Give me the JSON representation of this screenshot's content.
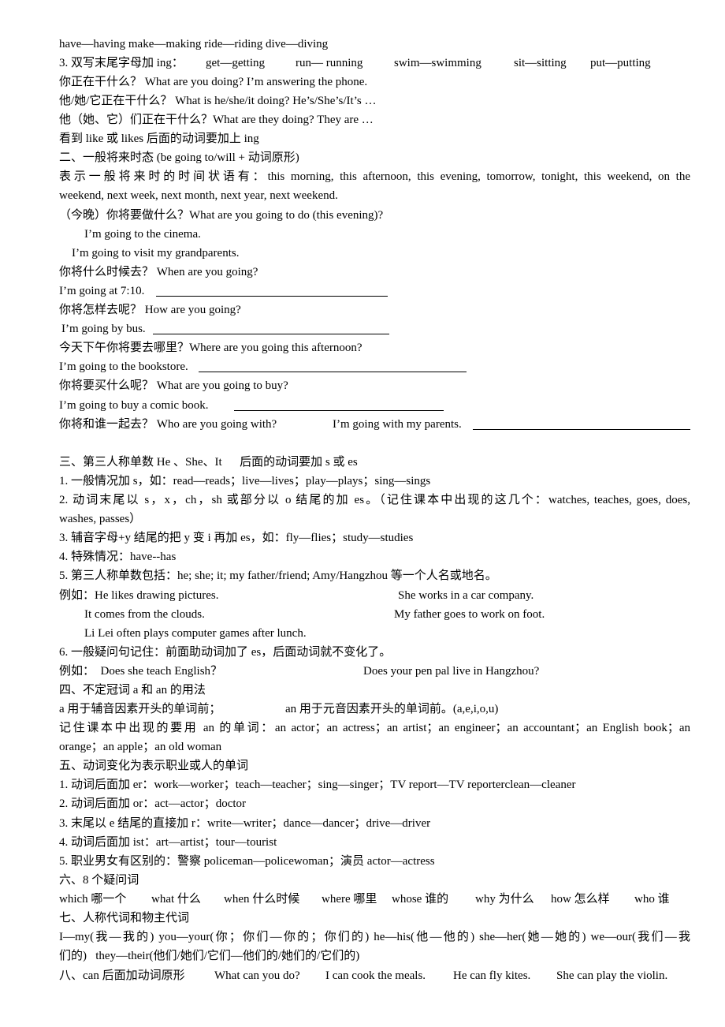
{
  "lines": {
    "l1": "have—having  make—making  ride—riding  dive—diving",
    "l2": [
      "3. 双写末尾字母加 ing：",
      "get—getting",
      "run— running",
      "swim—swimming",
      "sit—sitting",
      "put—putting"
    ],
    "l3": "你正在干什么？ What are you doing? I’m answering the phone.",
    "l4": "他/她/它正在干什么？ What is he/she/it doing?  He’s/She’s/It’s …",
    "l5": "他（她、它）们正在干什么？What are they doing?  They are …",
    "l6": "看到 like 或 likes 后面的动词要加上 ing",
    "s2": "二、一般将来时态 (be going to/will + 动词原形)",
    "l7": "表示一般将来时的时间状语有：this morning, this afternoon, this evening, tomorrow, tonight, this weekend, on the",
    "l8": "weekend, next week, next month, next year, next weekend.",
    "l9": "（今晚）你将要做什么？What are you going to do (this evening)?",
    "l10": "I’m going to the cinema.",
    "l11": "I’m going to visit my grandparents.",
    "l12": "你将什么时候去？ When are you going?",
    "l13": "I’m going at 7:10.",
    "l14": "你将怎样去呢？  How are you going?",
    "l15": "I’m going by bus.",
    "l16": "今天下午你将要去哪里？Where are you going this afternoon?",
    "l17": "I’m going to the bookstore.",
    "l18": "你将要买什么呢？ What are you going to buy?",
    "l19": "I’m going to buy a comic book.",
    "l20": [
      "你将和谁一起去？ Who are you going with?",
      "I’m going with my parents."
    ],
    "s3": "三、第三人称单数 He 、She、It      后面的动词要加 s 或 es",
    "l21": "1. 一般情况加 s，如：read—reads；live—lives；play—plays；sing—sings",
    "l22": "2. 动词末尾以 s，x，ch，sh 或部分以 o 结尾的加 es。（记住课本中出现的这几个：watches, teaches, goes, does,",
    "l23": "washes, passes）",
    "l24": "3. 辅音字母+y 结尾的把 y 变 i 再加 es，如：fly—flies；study—studies",
    "l25": "4. 特殊情况：have--has",
    "l26": "5. 第三人称单数包括：he; she; it; my father/friend; Amy/Hangzhou 等一个人名或地名。",
    "l27": [
      "例如：He likes drawing pictures.",
      "She works in a car company."
    ],
    "l28": [
      "It comes from the clouds.",
      "My father goes to work on foot."
    ],
    "l29": "Li Lei often plays computer games after lunch.",
    "l30": "6. 一般疑问句记住：前面助动词加了 es，后面动词就不变化了。",
    "l31": [
      "例如：  Does she teach English？",
      "Does your pen pal live in Hangzhou?"
    ],
    "s4": "四、不定冠词 a 和 an 的用法",
    "l32": [
      "a 用于辅音因素开头的单词前；",
      "an 用于元音因素开头的单词前。(a,e,i,o,u)"
    ],
    "l33": "记住课本中出现的要用 an 的单词：an actor；an actress；an artist；an engineer；an accountant；an English book；an",
    "l34": "orange；an apple；an old woman",
    "s5": "五、动词变化为表示职业或人的单词",
    "l35": "1. 动词后面加 er：work—worker；teach—teacher；sing—singer；TV report—TV reporterclean—cleaner",
    "l36": "2. 动词后面加 or：act—actor；doctor",
    "l37": "3. 末尾以 e 结尾的直接加 r：write—writer；dance—dancer；drive—driver",
    "l38": "4. 动词后面加 ist：art—artist；tour—tourist",
    "l39": "5. 职业男女有区别的：警察 policeman—policewoman；演员 actor—actress",
    "s6": "六、8 个疑问词",
    "l40": [
      "which  哪一个",
      "what  什么",
      "when  什么时候",
      "where  哪里",
      "whose  谁的",
      "why  为什么",
      "how  怎么样",
      "who  谁"
    ],
    "s7": "七、人称代词和物主代词",
    "l41": "I—my(我—我的)  you—your(你；你们—你的；你们的)  he—his(他—他的)  she—her(她—她的)   we—our(我们—我",
    "l42": "们的)   they—their(他们/她们/它们—他们的/她们的/它们的)",
    "l43": [
      "八、can 后面加动词原形",
      "What can you do?",
      "I can cook the meals.",
      "He can fly kites.",
      "She can play the violin."
    ]
  }
}
